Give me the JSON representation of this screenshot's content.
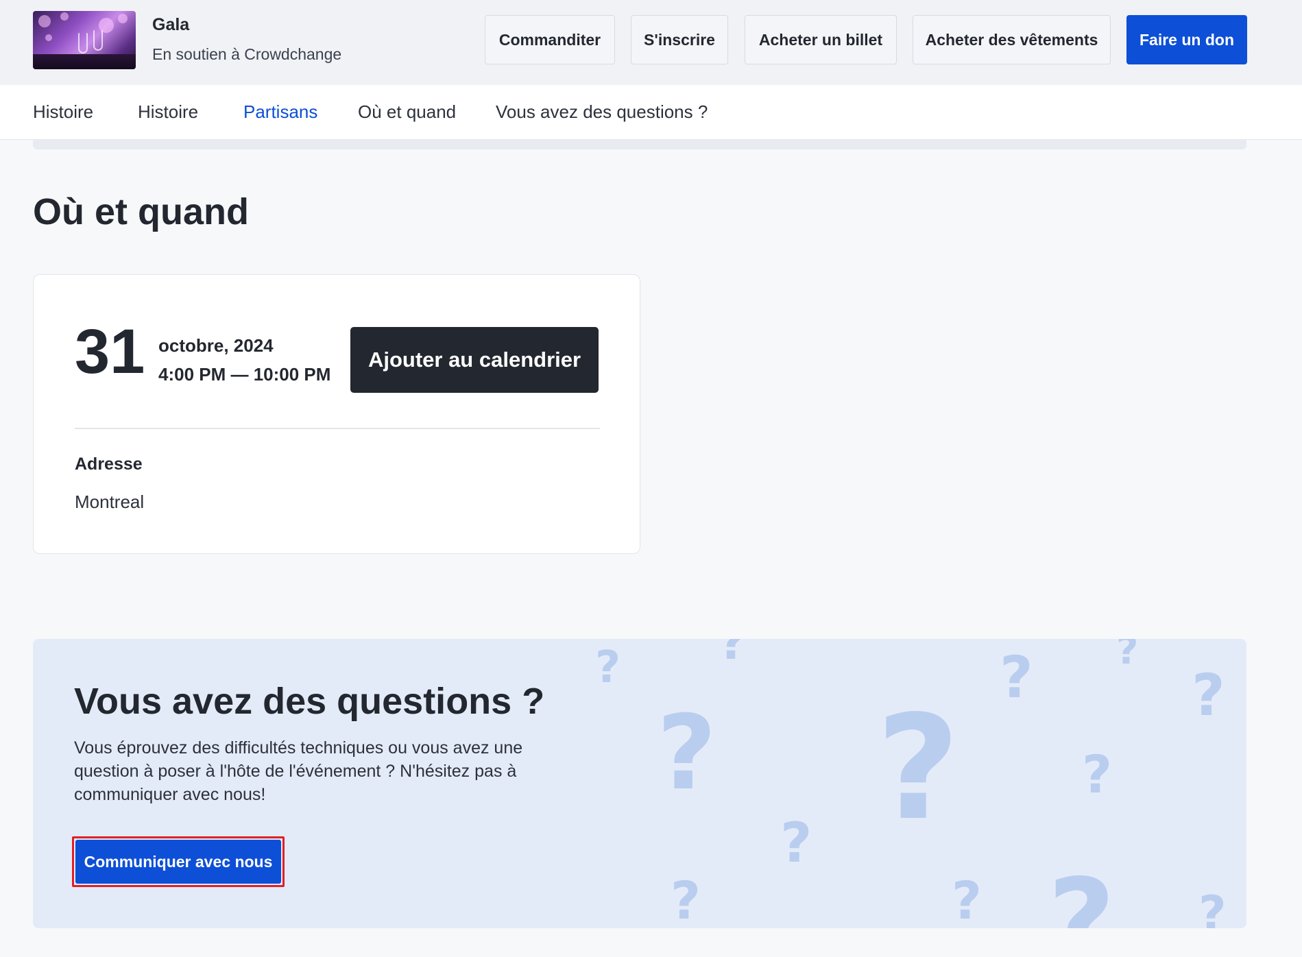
{
  "header": {
    "event_name": "Gala",
    "supporting": "En soutien à Crowdchange",
    "buttons": {
      "sponsor": "Commanditer",
      "register": "S'inscrire",
      "buy_ticket": "Acheter un billet",
      "buy_clothes": "Acheter des vêtements",
      "donate": "Faire un don"
    }
  },
  "nav": {
    "items": [
      {
        "label": "Histoire"
      },
      {
        "label": "Histoire"
      },
      {
        "label": "Partisans"
      },
      {
        "label": "Où et quand"
      },
      {
        "label": "Vous avez des questions ?"
      }
    ]
  },
  "where_when": {
    "title": "Où et quand",
    "day": "31",
    "month_year": "octobre, 2024",
    "time_range": "4:00 PM — 10:00 PM",
    "calendar_button": "Ajouter au calendrier",
    "address_label": "Adresse",
    "address_value": "Montreal"
  },
  "questions": {
    "title": "Vous avez des questions ?",
    "text": "Vous éprouvez des difficultés techniques ou vous avez une question à poser à l'hôte de l'événement ? N'hésitez pas à communiquer avec nous!",
    "contact_button": "Communiquer avec nous"
  },
  "colors": {
    "primary": "#0d4fd6",
    "dark": "#23272f",
    "panel": "#e4ebf8",
    "highlight": "#e01f26"
  }
}
